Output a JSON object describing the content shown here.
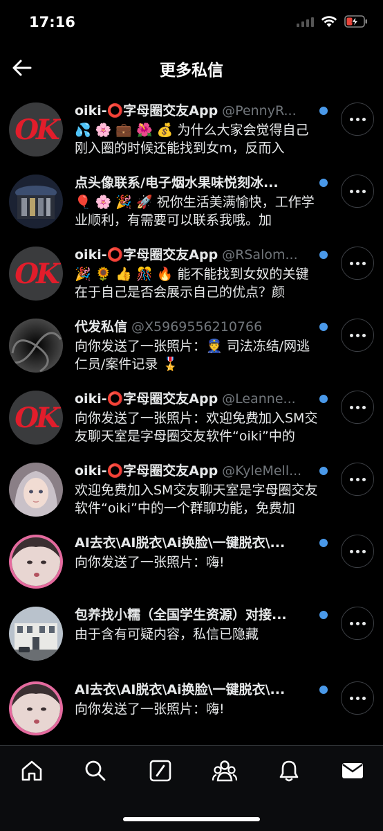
{
  "status": {
    "time": "17:16"
  },
  "header": {
    "title": "更多私信"
  },
  "conversations": [
    {
      "name": "oiki-⭕字母圈交友App",
      "handle": "@PennyR...",
      "message": "💦 🌸 💼 🌺 💰 为什么大家会觉得自己刚入圈的时候还能找到女m，反而入",
      "avatar": "ok-logo"
    },
    {
      "name": "点头像联系/电子烟水果味悦刻冰...",
      "handle": "",
      "message": "🎈 🌸 🎉 🚀 祝你生活美满愉快，工作学业顺利，有需要可以联系我哦。加",
      "avatar": "photo-product"
    },
    {
      "name": "oiki-⭕字母圈交友App",
      "handle": "@RSalom...",
      "message": "🎉 🌻 👍 🎊 🔥 能不能找到女奴的关键在于自己是否会展示自己的优点？颜",
      "avatar": "ok-logo"
    },
    {
      "name": "代发私信",
      "handle": "@X5969556210766",
      "message": "向你发送了一张照片：👮 司法冻结/网逃仁员/案件记录 🎖️",
      "avatar": "photo-dark"
    },
    {
      "name": "oiki-⭕字母圈交友App",
      "handle": "@Leanne...",
      "message": "向你发送了一张照片：欢迎免费加入SM交友聊天室是字母圈交友软件“oiki”中的",
      "avatar": "ok-logo"
    },
    {
      "name": "oiki-⭕字母圈交友App",
      "handle": "@KyleMell...",
      "message": "欢迎免费加入SM交友聊天室是字母圈交友软件“oiki”中的一个群聊功能，免费加",
      "avatar": "photo-girl"
    },
    {
      "name": "AI去衣\\AI脱衣\\Ai换脸\\一键脱衣\\...",
      "handle": "",
      "message": "向你发送了一张照片：嗨!",
      "avatar": "photo-ring"
    },
    {
      "name": "包养找小糯（全国学生资源）对接...",
      "handle": "",
      "message": "由于含有可疑内容，私信已隐藏",
      "avatar": "photo-building"
    },
    {
      "name": "AI去衣\\AI脱衣\\Ai换脸\\一键脱衣\\...",
      "handle": "",
      "message": "向你发送了一张照片：嗨!",
      "avatar": "photo-ring"
    }
  ],
  "avatar_text": {
    "ok": "OK"
  },
  "tabs": [
    {
      "name": "home-icon"
    },
    {
      "name": "search-icon"
    },
    {
      "name": "grok-icon"
    },
    {
      "name": "communities-icon"
    },
    {
      "name": "notifications-icon"
    },
    {
      "name": "messages-icon"
    }
  ],
  "colors": {
    "unread_dot": "#4a99e9",
    "ok_red": "#e21d2b",
    "ring_pink": "#e46a9e"
  }
}
